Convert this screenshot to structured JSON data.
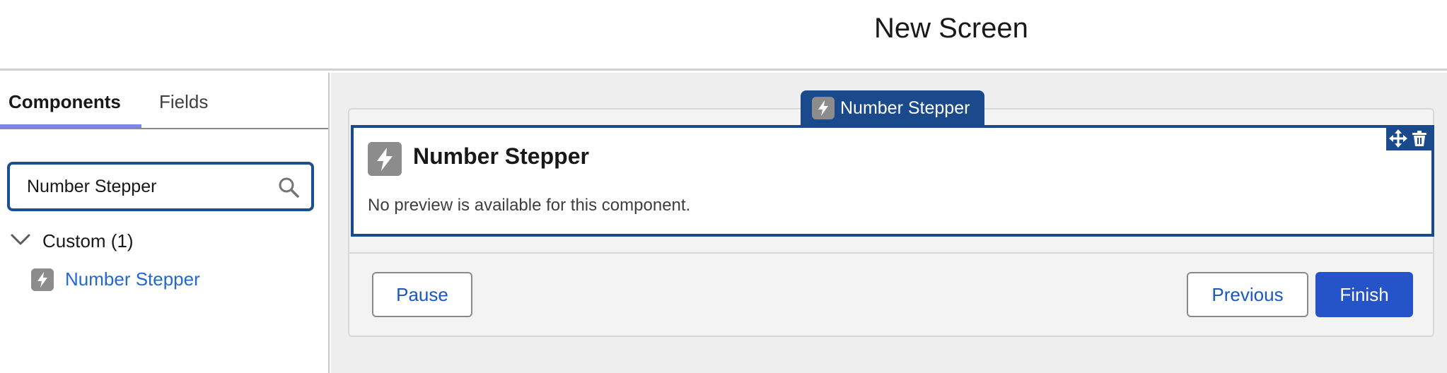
{
  "header": {
    "title": "New Screen"
  },
  "sidebar": {
    "tabs": [
      {
        "label": "Components"
      },
      {
        "label": "Fields"
      }
    ],
    "search": {
      "value": "Number Stepper",
      "icon": "search-icon"
    },
    "group": {
      "label": "Custom (1)",
      "icon": "chevron-down-icon"
    },
    "items": [
      {
        "label": "Number Stepper",
        "icon": "bolt-icon"
      }
    ]
  },
  "canvas": {
    "tag_label": "Number Stepper",
    "component": {
      "title": "Number Stepper",
      "note": "No preview is available for this component.",
      "icon": "bolt-icon"
    },
    "tools": [
      "move-icon",
      "trash-icon"
    ],
    "footer": {
      "pause_label": "Pause",
      "previous_label": "Previous",
      "finish_label": "Finish"
    }
  },
  "colors": {
    "accent": "#1a4a8c",
    "link": "#2367d1",
    "primary_button": "#2553c8",
    "tab_underline": "#7b86e8",
    "canvas_bg": "#efeeee"
  }
}
